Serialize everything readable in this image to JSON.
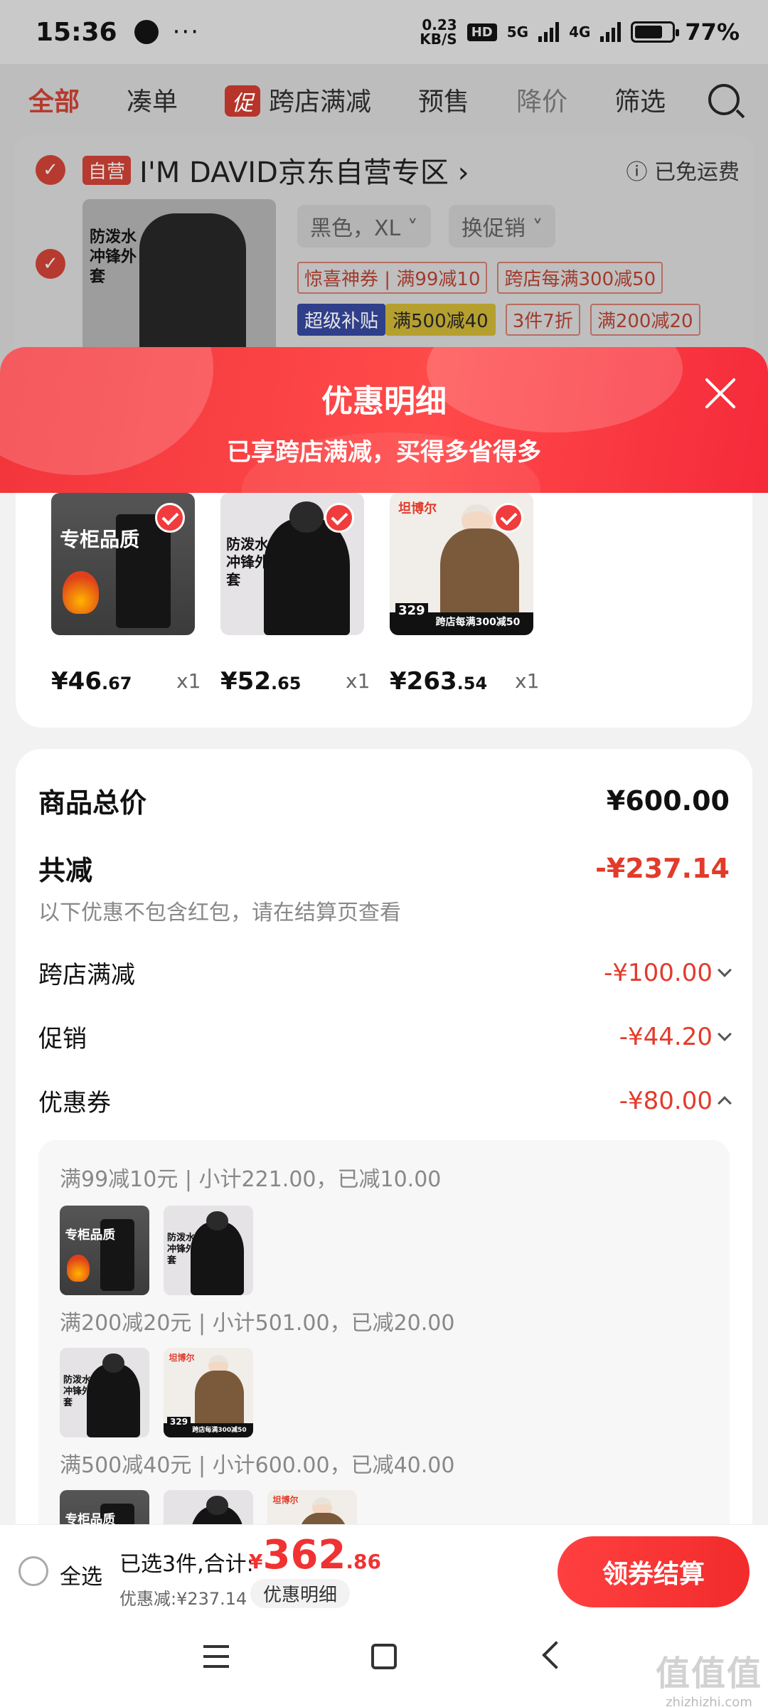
{
  "status_bar": {
    "time": "15:36",
    "net_speed": "0.23",
    "net_unit": "KB/S",
    "hd": "HD",
    "sig1": "5G",
    "sig2": "4G",
    "battery": "77%"
  },
  "background": {
    "tabs": [
      "全部",
      "凑单",
      "跨店满减",
      "预售",
      "降价",
      "筛选"
    ],
    "promo_badge": "促",
    "shop": {
      "self_tag": "自营",
      "name": "I'M DAVID京东自营专区 ›",
      "shipping": "ⓘ 已免运费"
    },
    "product": {
      "thumb_text": "防泼水冲锋外套",
      "variant": "黑色，XL ˅",
      "promo_chip": "换促销 ˅",
      "tags": [
        "惊喜神券",
        "满99减10",
        "跨店每满300减50",
        "超级补贴",
        "满500减40",
        "3件7折",
        "满200减20"
      ]
    }
  },
  "modal": {
    "title": "优惠明细",
    "subtitle": "已享跨店满减，买得多省得多",
    "items": [
      {
        "price_int": "¥46",
        "price_dec": ".67",
        "qty": "x1",
        "art": "pants",
        "label": "专柜品质"
      },
      {
        "price_int": "¥52",
        "price_dec": ".65",
        "qty": "x1",
        "art": "jacket",
        "label": "防泼水冲锋外套"
      },
      {
        "price_int": "¥263",
        "price_dec": ".54",
        "qty": "x1",
        "art": "puffer",
        "label": "跨店每满300减50",
        "brand": "坦博尔",
        "tag_price": "329"
      }
    ],
    "summary": {
      "total_label": "商品总价",
      "total_value": "¥600.00",
      "reduce_label": "共减",
      "reduce_value": "-¥237.14",
      "note": "以下优惠不包含红包，请在结算页查看",
      "rows": [
        {
          "label": "跨店满减",
          "value": "-¥100.00"
        },
        {
          "label": "促销",
          "value": "-¥44.20"
        },
        {
          "label": "优惠券",
          "value": "-¥80.00"
        }
      ],
      "coupon_groups": [
        {
          "title": "满99减10元 | 小计221.00，已减10.00"
        },
        {
          "title": "满200减20元 | 小计501.00，已减20.00"
        },
        {
          "title": "满500减40元 | 小计600.00，已减40.00"
        }
      ]
    }
  },
  "bottom": {
    "select_all": "全选",
    "selected_text": "已选3件,合计:",
    "total_symbol": "¥",
    "total_int": "362",
    "total_dec": ".86",
    "discount": "优惠减:¥237.14",
    "detail_chip": "优惠明细",
    "checkout": "领券结算"
  },
  "watermark": {
    "big": "值值值",
    "small": "zhizhizhi.com"
  },
  "colors": {
    "accent_red": "#f03232",
    "modal_header": "#f2353b"
  }
}
